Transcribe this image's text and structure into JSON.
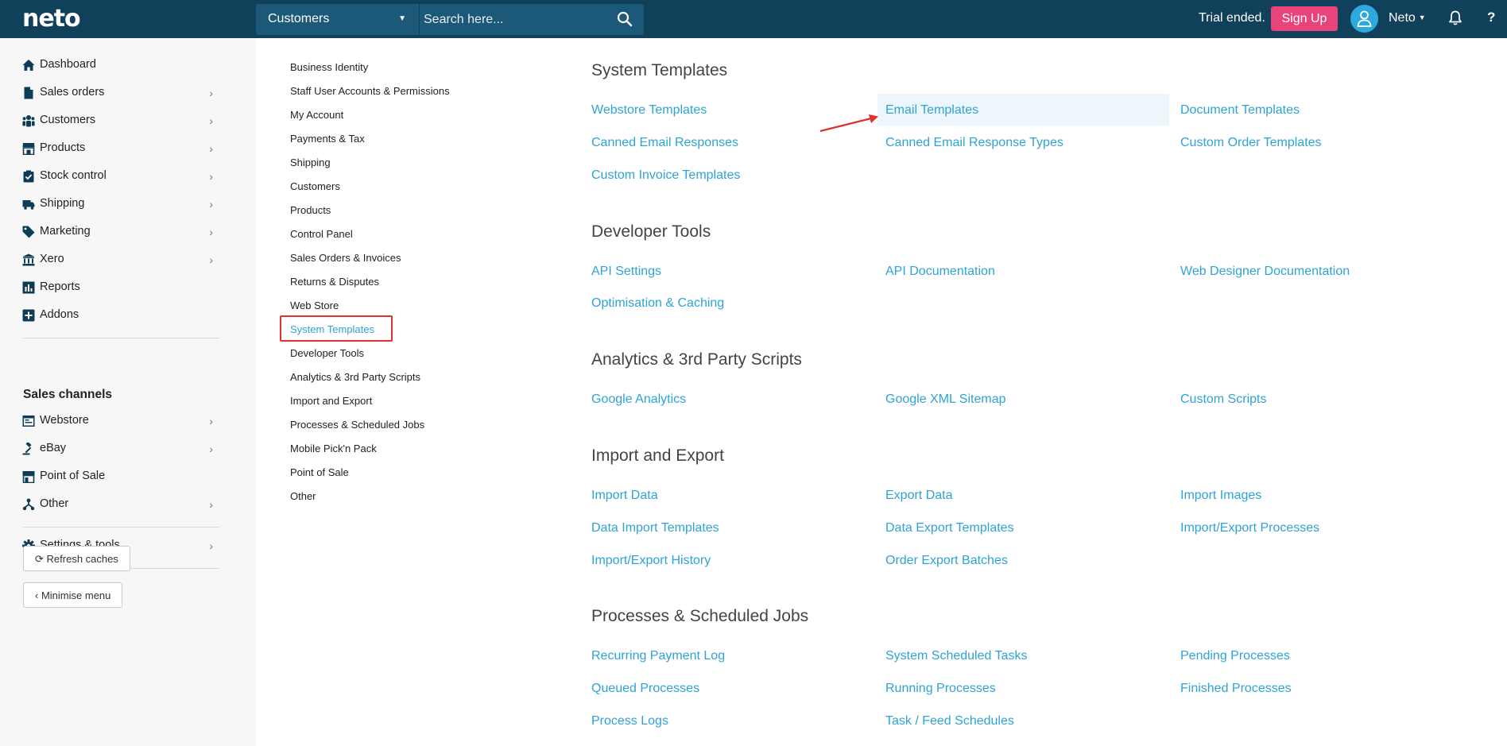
{
  "header": {
    "logo": "neto",
    "search_scope": "Customers",
    "search_placeholder": "Search here...",
    "trial_text": "Trial ended.",
    "signup_label": "Sign Up",
    "user_name": "Neto",
    "help_glyph": "?"
  },
  "sidebar": {
    "items": [
      {
        "label": "Dashboard",
        "icon": "home-icon",
        "has_submenu": false
      },
      {
        "label": "Sales orders",
        "icon": "document-icon",
        "has_submenu": true
      },
      {
        "label": "Customers",
        "icon": "users-icon",
        "has_submenu": true
      },
      {
        "label": "Products",
        "icon": "store-icon",
        "has_submenu": true
      },
      {
        "label": "Stock control",
        "icon": "clipboard-check-icon",
        "has_submenu": true
      },
      {
        "label": "Shipping",
        "icon": "truck-icon",
        "has_submenu": true
      },
      {
        "label": "Marketing",
        "icon": "tag-icon",
        "has_submenu": true
      },
      {
        "label": "Xero",
        "icon": "bank-icon",
        "has_submenu": true
      },
      {
        "label": "Reports",
        "icon": "bar-chart-icon",
        "has_submenu": false
      },
      {
        "label": "Addons",
        "icon": "plus-square-icon",
        "has_submenu": false
      }
    ],
    "sales_channels_heading": "Sales channels",
    "channels": [
      {
        "label": "Webstore",
        "icon": "browser-icon",
        "has_submenu": true
      },
      {
        "label": "eBay",
        "icon": "gavel-icon",
        "has_submenu": true
      },
      {
        "label": "Point of Sale",
        "icon": "shop-icon",
        "has_submenu": false
      },
      {
        "label": "Other",
        "icon": "sitemap-icon",
        "has_submenu": true
      }
    ],
    "settings_label": "Settings & tools",
    "refresh_label": "Refresh caches",
    "minimise_label": "Minimise menu"
  },
  "settings_menu": {
    "active": "System Templates",
    "items": [
      "Business Identity",
      "Staff User Accounts & Permissions",
      "My Account",
      "Payments & Tax",
      "Shipping",
      "Customers",
      "Products",
      "Control Panel",
      "Sales Orders & Invoices",
      "Returns & Disputes",
      "Web Store",
      "System Templates",
      "Developer Tools",
      "Analytics & 3rd Party Scripts",
      "Import and Export",
      "Processes & Scheduled Jobs",
      "Mobile Pick'n Pack",
      "Point of Sale",
      "Other"
    ]
  },
  "main": {
    "highlighted_link": "Email Templates",
    "sections": [
      {
        "title": "System Templates",
        "links": [
          "Webstore Templates",
          "Email Templates",
          "Document Templates",
          "Canned Email Responses",
          "Canned Email Response Types",
          "Custom Order Templates",
          "Custom Invoice Templates"
        ]
      },
      {
        "title": "Developer Tools",
        "links": [
          "API Settings",
          "API Documentation",
          "Web Designer Documentation",
          "Optimisation & Caching"
        ]
      },
      {
        "title": "Analytics & 3rd Party Scripts",
        "links": [
          "Google Analytics",
          "Google XML Sitemap",
          "Custom Scripts"
        ]
      },
      {
        "title": "Import and Export",
        "links": [
          "Import Data",
          "Export Data",
          "Import Images",
          "Data Import Templates",
          "Data Export Templates",
          "Import/Export Processes",
          "Import/Export History",
          "Order Export Batches"
        ]
      },
      {
        "title": "Processes & Scheduled Jobs",
        "links": [
          "Recurring Payment Log",
          "System Scheduled Tasks",
          "Pending Processes",
          "Queued Processes",
          "Running Processes",
          "Finished Processes",
          "Process Logs",
          "Task / Feed Schedules"
        ]
      }
    ]
  },
  "colors": {
    "topbar": "#10405a",
    "search_bg": "#1c5878",
    "signup": "#e8437a",
    "link": "#2ea3d6",
    "annotation_red": "#e03030",
    "highlight_bg": "#edf6fb"
  }
}
